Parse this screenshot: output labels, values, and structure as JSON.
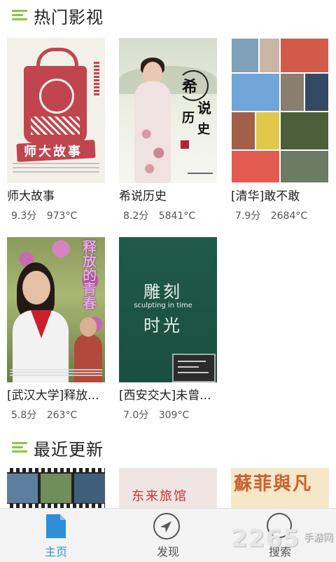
{
  "sections": {
    "hot": {
      "title": "热门影视"
    },
    "recent": {
      "title": "最近更新"
    }
  },
  "hot_items": [
    {
      "title": "师大故事",
      "score": "9.3分",
      "heat": "973°C",
      "poster_text": "师大故事"
    },
    {
      "title": "希说历史",
      "score": "8.2分",
      "heat": "5841°C",
      "poster_chars": [
        "希",
        "说",
        "历",
        "史"
      ]
    },
    {
      "title": "[清华]敢不敢",
      "score": "7.9分",
      "heat": "2684°C"
    },
    {
      "title": "[武汉大学]释放...",
      "score": "5.8分",
      "heat": "263°C",
      "poster_text": "释放的青春"
    },
    {
      "title": "[西安交大]未曾...",
      "score": "7.0分",
      "heat": "309°C",
      "poster_line1": "雕刻",
      "poster_line2": "sculpting in time",
      "poster_line3": "时光"
    }
  ],
  "recent_items": [
    {
      "poster_text": ""
    },
    {
      "poster_text": "东来旅馆"
    },
    {
      "poster_text": "蘇菲與凡"
    }
  ],
  "bottom_nav": {
    "home": "主页",
    "discover": "发现",
    "search": "搜索"
  },
  "watermark": {
    "number": "2265",
    "text": "手游网"
  },
  "colors": {
    "accent_green": "#8cc63f",
    "active_blue": "#2f8fd6",
    "inactive": "#555555"
  }
}
